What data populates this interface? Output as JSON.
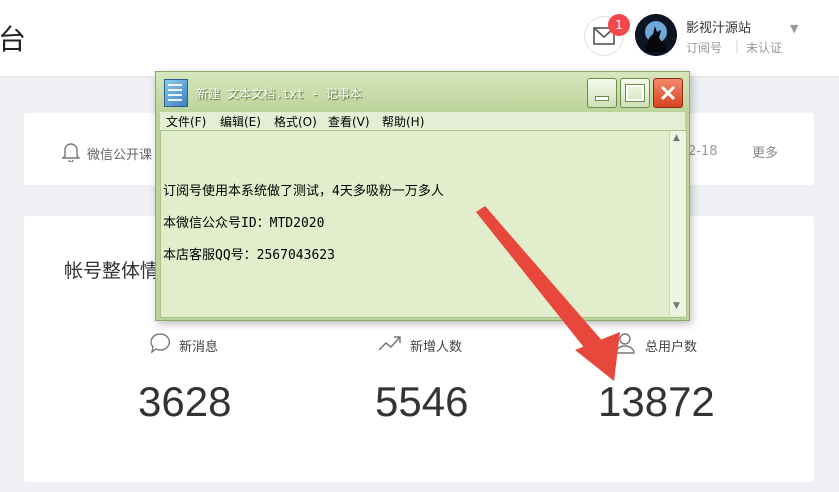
{
  "header": {
    "brand_fragment": "台",
    "mail_badge": "1",
    "account": {
      "name": "影视汁源站",
      "type": "订阅号",
      "separator": "|",
      "verify_status": "未认证"
    }
  },
  "notice": {
    "text": "微信公开课",
    "date": "2-18",
    "more": "更多"
  },
  "overview": {
    "title": "帐号整体情",
    "stats": [
      {
        "label": "新消息",
        "value": "3628",
        "icon": "chat-bubble-icon"
      },
      {
        "label": "新增人数",
        "value": "5546",
        "icon": "trend-up-icon"
      },
      {
        "label": "总用户数",
        "value": "13872",
        "icon": "user-icon"
      }
    ]
  },
  "notepad": {
    "title": "新建 文本文档.txt - 记事本",
    "menu": [
      "文件(F)",
      "编辑(E)",
      "格式(O)",
      "查看(V)",
      "帮助(H)"
    ],
    "lines": [
      "订阅号使用本系统做了测试，4天多吸粉一万多人",
      "本微信公众号ID：MTD2020",
      "本店客服QQ号：2567043623"
    ]
  },
  "colors": {
    "annotation_arrow": "#e8473b",
    "badge": "#f2484b",
    "notepad_bg": "#e2eecb"
  }
}
